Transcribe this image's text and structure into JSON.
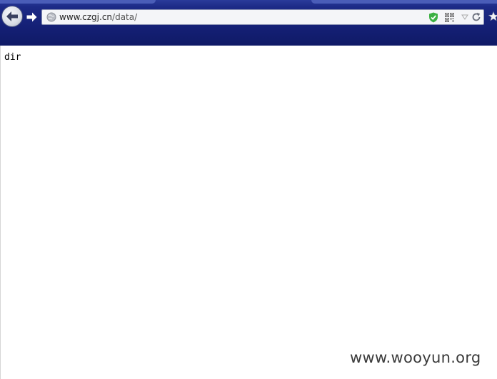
{
  "browser": {
    "address_host": "www.czgj.cn",
    "address_path": "/data/"
  },
  "page": {
    "body_text": "dir"
  },
  "watermark": {
    "text": "www.wooyun.org"
  },
  "icons": {
    "back": "back-arrow-icon",
    "forward": "forward-arrow-icon",
    "globe": "globe-icon",
    "security": "shield-check-icon",
    "qr": "qr-code-icon",
    "dropdown": "dropdown-arrow-icon",
    "reload": "reload-icon",
    "bookmark": "star-icon"
  },
  "colors": {
    "toolbar": "#141f74",
    "shield": "#3cb043"
  }
}
